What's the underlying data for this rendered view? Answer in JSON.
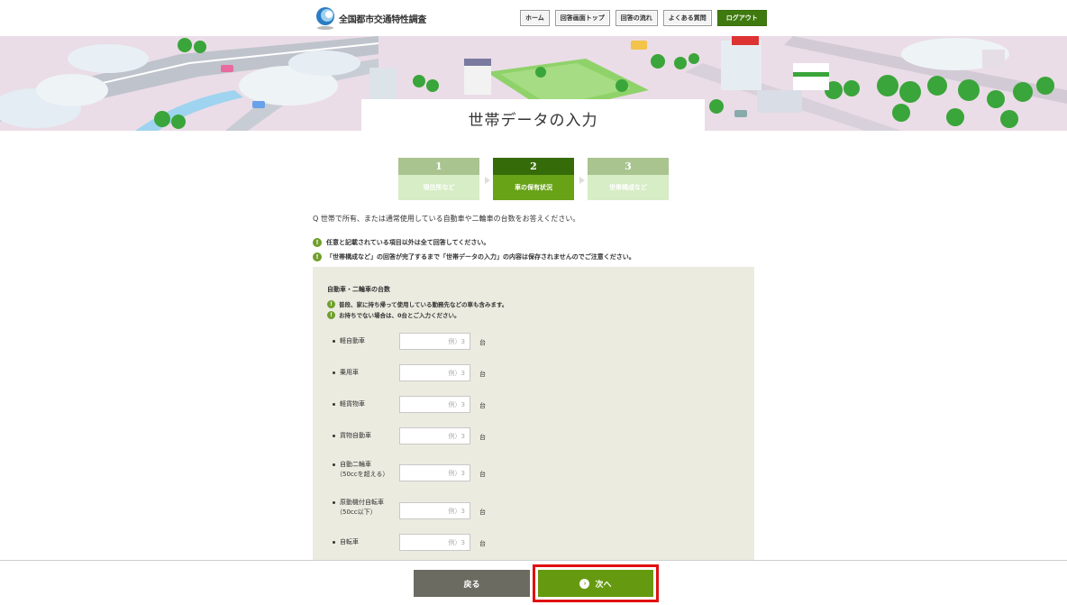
{
  "header": {
    "logo_text": "全国都市交通特性調査",
    "nav": [
      "ホーム",
      "回答画面トップ",
      "回答の流れ",
      "よくある質問"
    ],
    "logout": "ログアウト"
  },
  "page_title": "世帯データの入力",
  "steps": [
    {
      "num": "1",
      "label": "現住所など"
    },
    {
      "num": "2",
      "label": "車の保有状況"
    },
    {
      "num": "3",
      "label": "世帯構成など"
    }
  ],
  "question": "Q 世帯で所有、または通常使用している自動車や二輪車の台数をお答えください。",
  "notes": [
    "任意と記載されている項目以外は全て回答してください。",
    "「世帯構成など」の回答が完了するまで「世帯データの入力」の内容は保存されませんのでご注意ください。"
  ],
  "panel": {
    "title": "自動車・二輪車の台数",
    "notes": [
      "普段、家に持ち帰って使用している勤務先などの車も含みます。",
      "お持ちでない場合は、0台とご入力ください。"
    ],
    "placeholder": "例）3",
    "unit": "台",
    "rows": [
      {
        "label": "軽自動車",
        "sub": ""
      },
      {
        "label": "乗用車",
        "sub": ""
      },
      {
        "label": "軽貨物車",
        "sub": ""
      },
      {
        "label": "貨物自動車",
        "sub": ""
      },
      {
        "label": "自動二輪車",
        "sub": "（50ccを超える）"
      },
      {
        "label": "原動機付自転車",
        "sub": "（50cc以下）"
      },
      {
        "label": "自転車",
        "sub": ""
      }
    ]
  },
  "buttons": {
    "back": "戻る",
    "next": "次へ"
  }
}
